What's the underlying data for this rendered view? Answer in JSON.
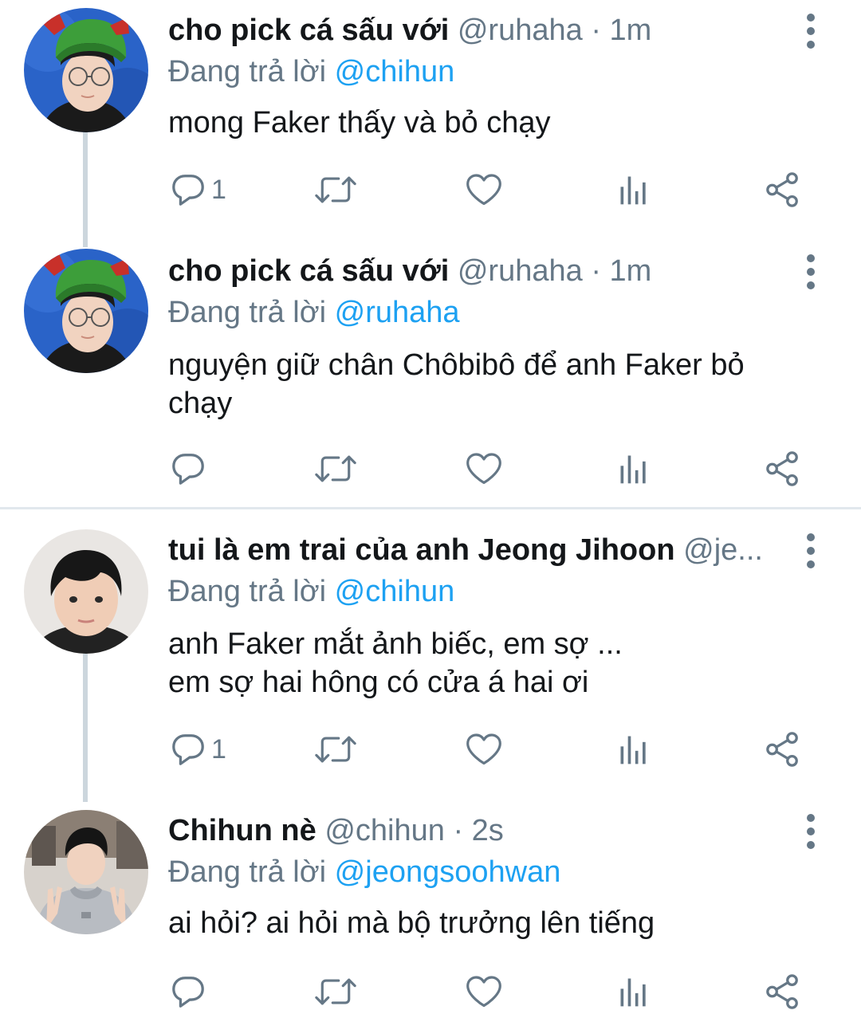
{
  "reply_prefix": "Đang trả lời",
  "tweets": [
    {
      "name": "cho pick cá sấu với",
      "handle": "@ruhaha",
      "separator": "·",
      "time": "1m",
      "reply_to": "@chihun",
      "text": "mong Faker thấy và bỏ chạy",
      "reply_count": "1"
    },
    {
      "name": "cho pick cá sấu với",
      "handle": "@ruhaha",
      "separator": "·",
      "time": "1m",
      "reply_to": "@ruhaha",
      "text": "nguyện giữ chân Chôbibô để anh Faker bỏ chạy",
      "reply_count": ""
    },
    {
      "name": "tui là em trai của anh Jeong Jihoon",
      "handle": "@je...",
      "separator": "",
      "time": "",
      "reply_to": "@chihun",
      "text_line1": "anh Faker mắt ảnh biếc, em sợ ...",
      "text_line2": "em sợ hai hông có cửa á hai ơi",
      "reply_count": "1"
    },
    {
      "name": "Chihun nè",
      "handle": "@chihun",
      "separator": "·",
      "time": "2s",
      "reply_to": "@jeongsoohwan",
      "text": "ai hỏi? ai hỏi mà bộ trưởng lên tiếng",
      "reply_count": ""
    }
  ],
  "colors": {
    "text": "#14171a",
    "secondary": "#657786",
    "link": "#1da1f2",
    "thread_line": "#ccd6dd",
    "divider": "#e1e8ed"
  },
  "icons": [
    "reply-icon",
    "retweet-icon",
    "like-icon",
    "analytics-icon",
    "share-icon",
    "more-vertical-icon"
  ]
}
